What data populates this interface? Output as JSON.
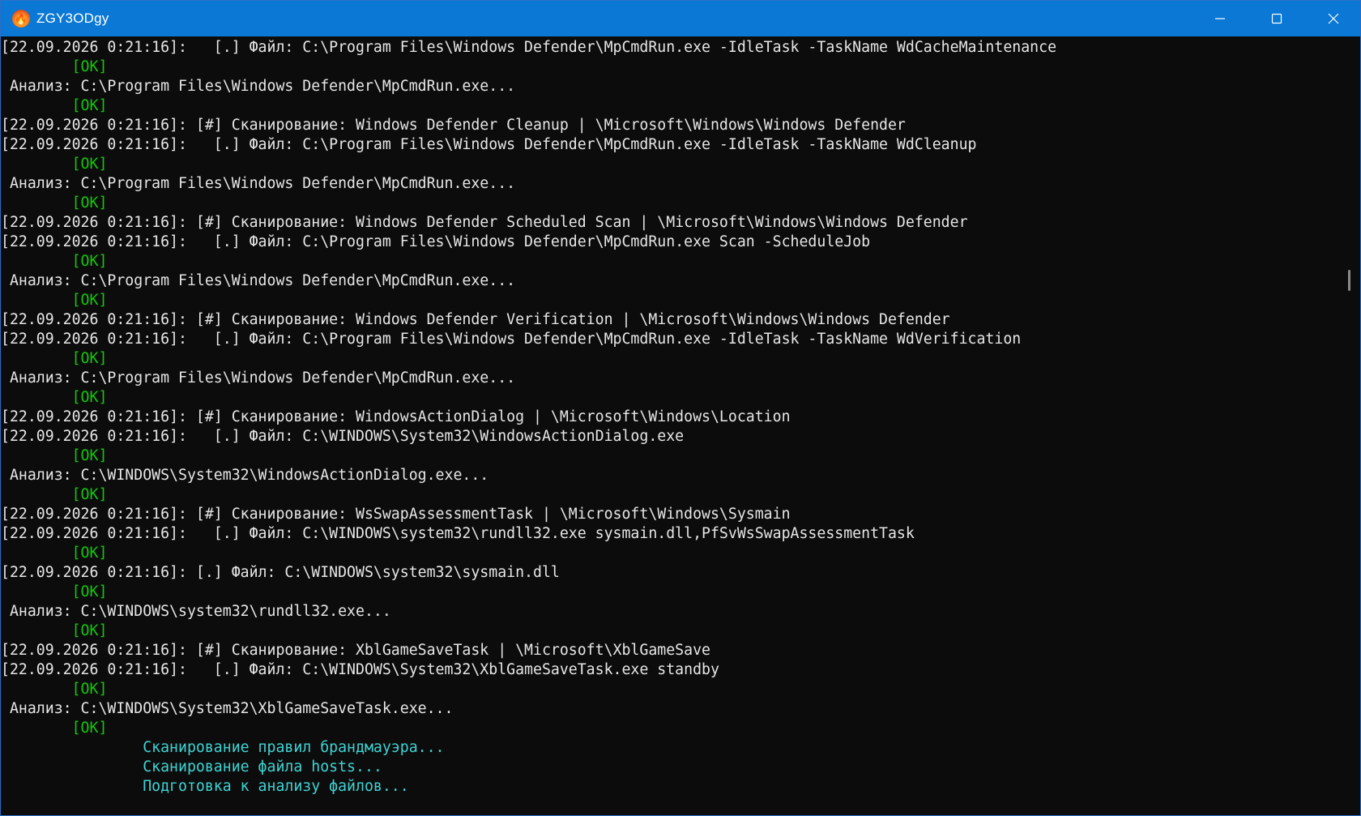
{
  "window": {
    "title": "ZGY3ODgy",
    "app_icon": "flame-icon",
    "colors": {
      "titlebar": "#0a78d4",
      "background": "#0c0c0c",
      "text": "#e6e6e6",
      "ok": "#16c60c",
      "info": "#3fd3d3"
    }
  },
  "console": {
    "lines": [
      {
        "type": "log",
        "text": "[22.09.2026 0:21:16]:   [.] Файл: C:\\Program Files\\Windows Defender\\MpCmdRun.exe -IdleTask -TaskName WdCacheMaintenance"
      },
      {
        "type": "ok",
        "text": "        [OK]"
      },
      {
        "type": "log",
        "text": " Анализ: C:\\Program Files\\Windows Defender\\MpCmdRun.exe..."
      },
      {
        "type": "ok",
        "text": "        [OK]"
      },
      {
        "type": "log",
        "text": "[22.09.2026 0:21:16]: [#] Сканирование: Windows Defender Cleanup | \\Microsoft\\Windows\\Windows Defender"
      },
      {
        "type": "log",
        "text": "[22.09.2026 0:21:16]:   [.] Файл: C:\\Program Files\\Windows Defender\\MpCmdRun.exe -IdleTask -TaskName WdCleanup"
      },
      {
        "type": "ok",
        "text": "        [OK]"
      },
      {
        "type": "log",
        "text": " Анализ: C:\\Program Files\\Windows Defender\\MpCmdRun.exe..."
      },
      {
        "type": "ok",
        "text": "        [OK]"
      },
      {
        "type": "log",
        "text": "[22.09.2026 0:21:16]: [#] Сканирование: Windows Defender Scheduled Scan | \\Microsoft\\Windows\\Windows Defender"
      },
      {
        "type": "log",
        "text": "[22.09.2026 0:21:16]:   [.] Файл: C:\\Program Files\\Windows Defender\\MpCmdRun.exe Scan -ScheduleJob"
      },
      {
        "type": "ok",
        "text": "        [OK]"
      },
      {
        "type": "log",
        "text": " Анализ: C:\\Program Files\\Windows Defender\\MpCmdRun.exe..."
      },
      {
        "type": "ok",
        "text": "        [OK]"
      },
      {
        "type": "log",
        "text": "[22.09.2026 0:21:16]: [#] Сканирование: Windows Defender Verification | \\Microsoft\\Windows\\Windows Defender"
      },
      {
        "type": "log",
        "text": "[22.09.2026 0:21:16]:   [.] Файл: C:\\Program Files\\Windows Defender\\MpCmdRun.exe -IdleTask -TaskName WdVerification"
      },
      {
        "type": "ok",
        "text": "        [OK]"
      },
      {
        "type": "log",
        "text": " Анализ: C:\\Program Files\\Windows Defender\\MpCmdRun.exe..."
      },
      {
        "type": "ok",
        "text": "        [OK]"
      },
      {
        "type": "log",
        "text": "[22.09.2026 0:21:16]: [#] Сканирование: WindowsActionDialog | \\Microsoft\\Windows\\Location"
      },
      {
        "type": "log",
        "text": "[22.09.2026 0:21:16]:   [.] Файл: C:\\WINDOWS\\System32\\WindowsActionDialog.exe"
      },
      {
        "type": "ok",
        "text": "        [OK]"
      },
      {
        "type": "log",
        "text": " Анализ: C:\\WINDOWS\\System32\\WindowsActionDialog.exe..."
      },
      {
        "type": "ok",
        "text": "        [OK]"
      },
      {
        "type": "log",
        "text": "[22.09.2026 0:21:16]: [#] Сканирование: WsSwapAssessmentTask | \\Microsoft\\Windows\\Sysmain"
      },
      {
        "type": "log",
        "text": "[22.09.2026 0:21:16]:   [.] Файл: C:\\WINDOWS\\system32\\rundll32.exe sysmain.dll,PfSvWsSwapAssessmentTask"
      },
      {
        "type": "ok",
        "text": "        [OK]"
      },
      {
        "type": "log",
        "text": "[22.09.2026 0:21:16]: [.] Файл: C:\\WINDOWS\\system32\\sysmain.dll"
      },
      {
        "type": "ok",
        "text": "        [OK]"
      },
      {
        "type": "log",
        "text": " Анализ: C:\\WINDOWS\\system32\\rundll32.exe..."
      },
      {
        "type": "ok",
        "text": "        [OK]"
      },
      {
        "type": "log",
        "text": "[22.09.2026 0:21:16]: [#] Сканирование: XblGameSaveTask | \\Microsoft\\XblGameSave"
      },
      {
        "type": "log",
        "text": "[22.09.2026 0:21:16]:   [.] Файл: C:\\WINDOWS\\System32\\XblGameSaveTask.exe standby"
      },
      {
        "type": "ok",
        "text": "        [OK]"
      },
      {
        "type": "log",
        "text": " Анализ: C:\\WINDOWS\\System32\\XblGameSaveTask.exe..."
      },
      {
        "type": "ok",
        "text": "        [OK]"
      },
      {
        "type": "info",
        "text": "                Сканирование правил брандмауэра..."
      },
      {
        "type": "info",
        "text": "                Сканирование файла hosts..."
      },
      {
        "type": "info",
        "text": "                Подготовка к анализу файлов..."
      }
    ]
  }
}
